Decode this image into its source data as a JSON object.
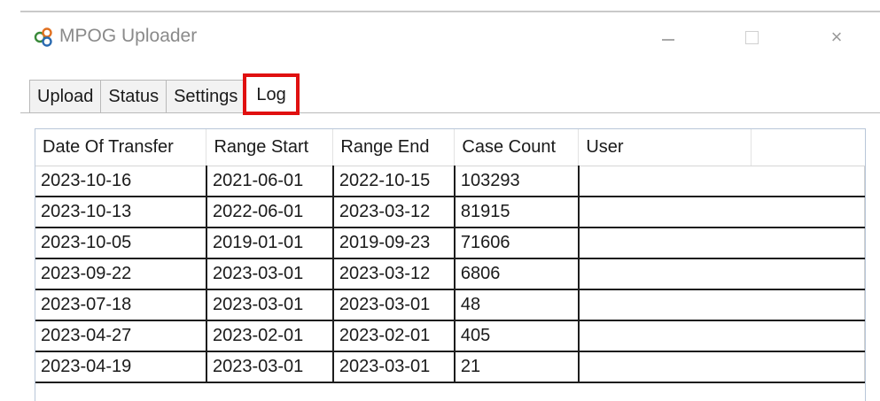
{
  "window": {
    "title": "MPOG Uploader",
    "icon": "mpog-logo-icon",
    "controls": [
      "minimize-icon",
      "maximize-icon",
      "close-icon"
    ],
    "close_glyph": "×"
  },
  "tabs": [
    {
      "label": "Upload"
    },
    {
      "label": "Status"
    },
    {
      "label": "Settings"
    },
    {
      "label": "Log",
      "selected": true,
      "highlight_color": "#e01010"
    }
  ],
  "log_table": {
    "columns": [
      "Date Of Transfer",
      "Range Start",
      "Range End",
      "Case Count",
      "User",
      ""
    ],
    "rows": [
      {
        "date": "2023-10-16",
        "start": "2021-06-01",
        "end": "2022-10-15",
        "count": "103293",
        "user": ""
      },
      {
        "date": "2023-10-13",
        "start": "2022-06-01",
        "end": "2023-03-12",
        "count": "81915",
        "user": ""
      },
      {
        "date": "2023-10-05",
        "start": "2019-01-01",
        "end": "2019-09-23",
        "count": "71606",
        "user": ""
      },
      {
        "date": "2023-09-22",
        "start": "2023-03-01",
        "end": "2023-03-12",
        "count": "6806",
        "user": ""
      },
      {
        "date": "2023-07-18",
        "start": "2023-03-01",
        "end": "2023-03-01",
        "count": "48",
        "user": ""
      },
      {
        "date": "2023-04-27",
        "start": "2023-02-01",
        "end": "2023-02-01",
        "count": "405",
        "user": ""
      },
      {
        "date": "2023-04-19",
        "start": "2023-03-01",
        "end": "2023-03-01",
        "count": "21",
        "user": ""
      }
    ]
  }
}
